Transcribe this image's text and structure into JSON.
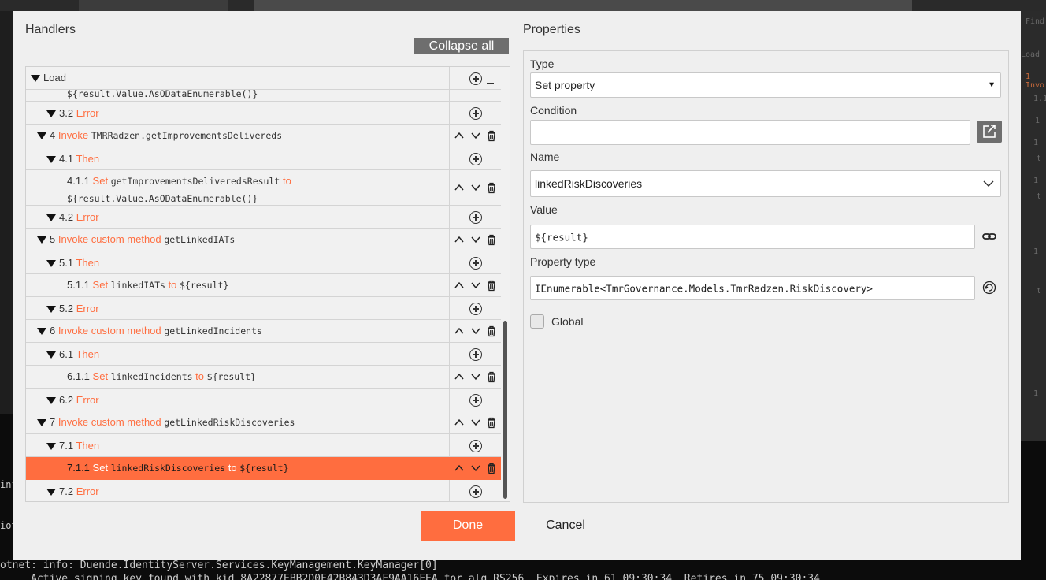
{
  "background": {
    "right_panel_lines": [
      "Find",
      "Load",
      "1 Invo",
      "1.1",
      "1",
      "1",
      "t",
      "1",
      "t",
      "t",
      "1",
      "1"
    ],
    "terminal": {
      "line1": "otnet: info: Duende.IdentityServer.Services.KeyManagement.KeyManager[0]",
      "line2": "     Active signing key found with kid 8A22877EBB2D0F42B843D3AF9AA16FEA for alg RS256. Expires in 61.09:30:34. Retires in 75.09:30:34",
      "left_fragments": [
        "inf",
        "iot"
      ]
    }
  },
  "dialog": {
    "handlers_title": "Handlers",
    "collapse_all_label": "Collapse all",
    "properties_title": "Properties",
    "done_label": "Done",
    "cancel_label": "Cancel"
  },
  "tree": {
    "root_label": "Load",
    "rows": [
      {
        "continuation": "${result.Value.AsODataEnumerable()}"
      },
      {
        "num": "3.2",
        "kw": "Error"
      },
      {
        "num": "4",
        "kw": "Invoke",
        "code": "TMRRadzen.getImprovementsDelivereds"
      },
      {
        "num": "4.1",
        "kw": "Then"
      },
      {
        "num": "4.1.1",
        "kw": "Set",
        "code": "getImprovementsDeliveredsResult",
        "kw2": "to",
        "code2": "${result.Value.AsODataEnumerable()}"
      },
      {
        "num": "4.2",
        "kw": "Error"
      },
      {
        "num": "5",
        "kw": "Invoke custom method",
        "code": "getLinkedIATs"
      },
      {
        "num": "5.1",
        "kw": "Then"
      },
      {
        "num": "5.1.1",
        "kw": "Set",
        "code": "linkedIATs",
        "kw2": "to",
        "code2": "${result}"
      },
      {
        "num": "5.2",
        "kw": "Error"
      },
      {
        "num": "6",
        "kw": "Invoke custom method",
        "code": "getLinkedIncidents"
      },
      {
        "num": "6.1",
        "kw": "Then"
      },
      {
        "num": "6.1.1",
        "kw": "Set",
        "code": "linkedIncidents",
        "kw2": "to",
        "code2": "${result}"
      },
      {
        "num": "6.2",
        "kw": "Error"
      },
      {
        "num": "7",
        "kw": "Invoke custom method",
        "code": "getLinkedRiskDiscoveries"
      },
      {
        "num": "7.1",
        "kw": "Then"
      },
      {
        "num": "7.1.1",
        "kw": "Set",
        "code": "linkedRiskDiscoveries",
        "kw2": "to",
        "code2": "${result}"
      },
      {
        "num": "7.2",
        "kw": "Error"
      }
    ]
  },
  "properties": {
    "type_label": "Type",
    "type_value": "Set property",
    "condition_label": "Condition",
    "condition_value": "",
    "name_label": "Name",
    "name_value": "linkedRiskDiscoveries",
    "value_label": "Value",
    "value_value": "${result}",
    "property_type_label": "Property type",
    "property_type_value": "IEnumerable<TmrGovernance.Models.TmrRadzen.RiskDiscovery>",
    "global_label": "Global",
    "global_checked": false
  },
  "colors": {
    "accent": "#ff6d3f",
    "dialog_bg": "#efefef",
    "collapse_btn": "#6e6e6e"
  }
}
